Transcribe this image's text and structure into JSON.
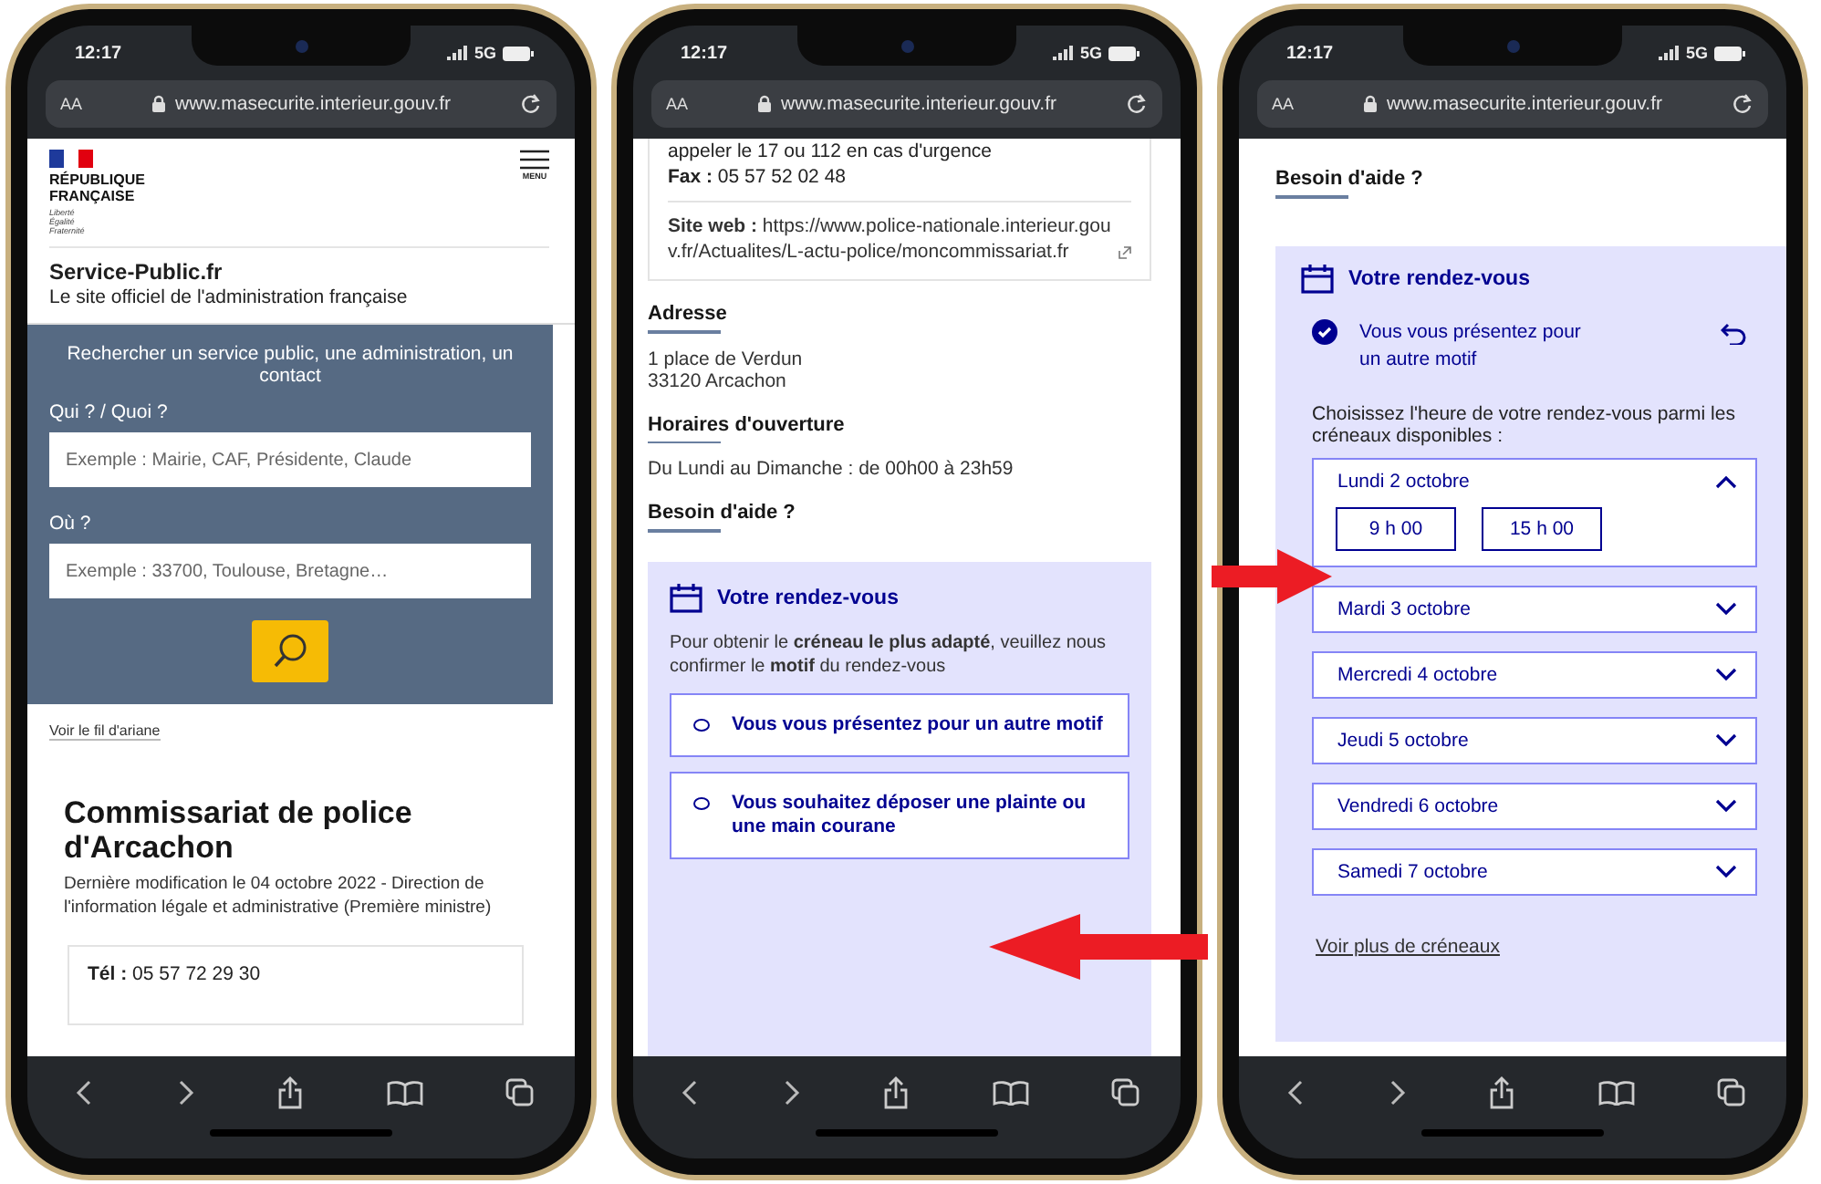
{
  "phones": [
    {
      "kind": "home",
      "status": {
        "time": "12:17",
        "network": "5G"
      },
      "address_bar": {
        "text_size": "AA",
        "url": "www.masecurite.interieur.gouv.fr"
      },
      "header": {
        "logo_text": "RÉPUBLIQUE FRANÇAISE",
        "motto": [
          "Liberté",
          "Égalité",
          "Fraternité"
        ],
        "menu_label": "MENU",
        "site_name": "Service-Public.fr",
        "tagline": "Le site officiel de l'administration française"
      },
      "search": {
        "heading": "Rechercher un service public, une administration, un contact",
        "fields": [
          {
            "label": "Qui ? / Quoi ?",
            "placeholder": "Exemple : Mairie, CAF, Présidente, Claude"
          },
          {
            "label": "Où ?",
            "placeholder": "Exemple : 33700, Toulouse, Bretagne…"
          }
        ]
      },
      "breadcrumb_link": "Voir le fil d'ariane",
      "title": "Commissariat de police d'Arcachon",
      "meta": "Dernière modification le 04 octobre 2022 - Direction de l'information légale et administrative (Première ministre)",
      "contact_lines": [
        "**Tél :** 05 57 72 29 30"
      ]
    },
    {
      "kind": "details",
      "status": {
        "time": "12:17",
        "network": "5G"
      },
      "address_bar": {
        "text_size": "AA",
        "url": "www.masecurite.interieur.gouv.fr"
      },
      "contact_lines": [
        "appeler le 17 ou 112 en cas d'urgence",
        "**Fax :** 05 57 52 02 48"
      ],
      "website": "**Site web :** https://www.police-nationale.interieur.gouv.fr/Actualites/L-actu-police/moncommissariat.fr",
      "sections": [
        {
          "heading": "Adresse",
          "lines": [
            "1 place de Verdun",
            "33120 Arcachon"
          ]
        },
        {
          "heading": "Horaires d'ouverture",
          "lines": [
            "Du Lundi au Dimanche : de 00h00 à 23h59"
          ]
        }
      ],
      "help_heading": "Besoin d'aide ?",
      "appointment": {
        "title": "Votre rendez-vous",
        "intro": "Pour obtenir le **créneau le plus adapté**, veuillez nous confirmer le **motif** du rendez-vous",
        "options": [
          {
            "label": "Vous vous présentez pour un autre motif",
            "selected": false
          },
          {
            "label": "Vous souhaitez déposer une plainte ou une main courane",
            "selected": false
          }
        ]
      }
    },
    {
      "kind": "booking",
      "status": {
        "time": "12:17",
        "network": "5G"
      },
      "address_bar": {
        "text_size": "AA",
        "url": "www.masecurite.interieur.gouv.fr"
      },
      "help_heading": "Besoin d'aide ?",
      "appointment": {
        "title": "Votre rendez-vous",
        "chosen_reason": "Vous vous présentez pour un autre motif",
        "prompt": "Choisissez l'heure de votre rendez-vous parmi les créneaux disponibles :",
        "days": [
          {
            "label": "Lundi 2 octobre",
            "expanded": true,
            "slots": [
              "9 h 00",
              "15 h 00"
            ]
          },
          {
            "label": "Mardi 3 octobre",
            "expanded": false
          },
          {
            "label": "Mercredi 4 octobre",
            "expanded": false
          },
          {
            "label": "Jeudi 5 octobre",
            "expanded": false
          },
          {
            "label": "Vendredi 6 octobre",
            "expanded": false
          },
          {
            "label": "Samedi 7 octobre",
            "expanded": false
          }
        ],
        "more_link": "Voir plus de créneaux"
      }
    }
  ]
}
